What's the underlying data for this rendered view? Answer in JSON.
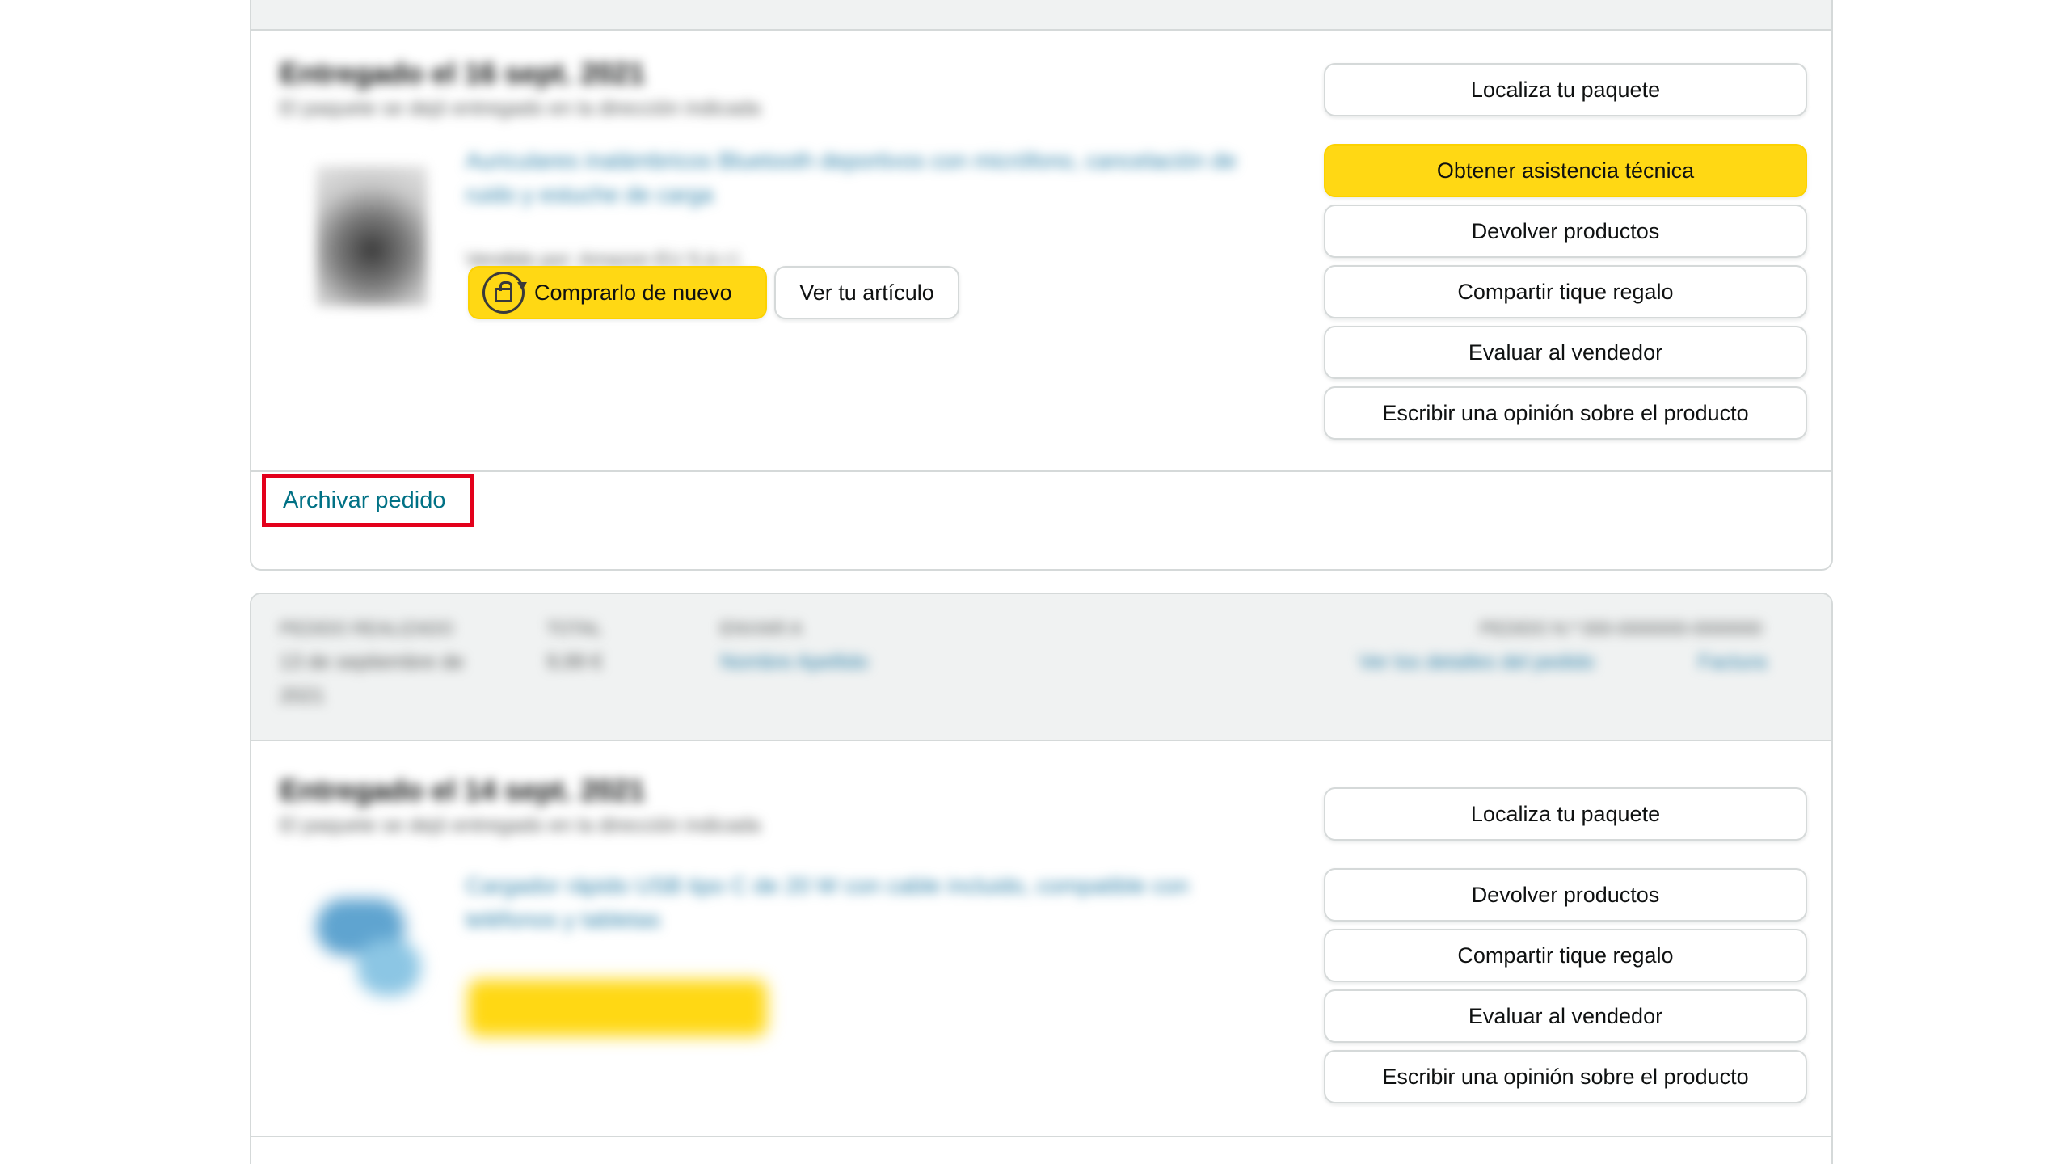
{
  "orders": [
    {
      "delivery_title": "Entregado el 16 sept. 2021",
      "delivery_subtitle": "El paquete se dejó entregado en la dirección indicada",
      "product_title": "Auriculares inalámbricos Bluetooth deportivos con micrófono, cancelación de ruido y estuche de carga",
      "product_seller": "Vendido por: Amazon EU S.à r.l.",
      "buy_again_label": "Comprarlo de nuevo",
      "view_item_label": "Ver tu artículo",
      "actions": [
        "Localiza tu paquete",
        "Obtener asistencia técnica",
        "Devolver productos",
        "Compartir tique regalo",
        "Evaluar al vendedor",
        "Escribir una opinión sobre el producto"
      ],
      "archive_label": "Archivar pedido"
    },
    {
      "header": {
        "date_label": "PEDIDO REALIZADO",
        "date_value_1": "13 de septiembre de",
        "date_value_2": "2021",
        "total_label": "TOTAL",
        "total_value": "9,99 €",
        "ship_to_label": "ENVIAR A",
        "ship_to_value": "Nombre Apellido",
        "order_number_label": "PEDIDO N.º 000-0000000-0000000",
        "details_link": "Ver los detalles del pedido",
        "invoice_link": "Factura"
      },
      "delivery_title": "Entregado el 14 sept. 2021",
      "delivery_subtitle": "El paquete se dejó entregado en la dirección indicada",
      "product_title": "Cargador rápido USB tipo C de 20 W con cable incluido, compatible con teléfonos y tabletas",
      "actions": [
        "Localiza tu paquete",
        "Devolver productos",
        "Compartir tique regalo",
        "Evaluar al vendedor",
        "Escribir una opinión sobre el producto"
      ]
    }
  ]
}
